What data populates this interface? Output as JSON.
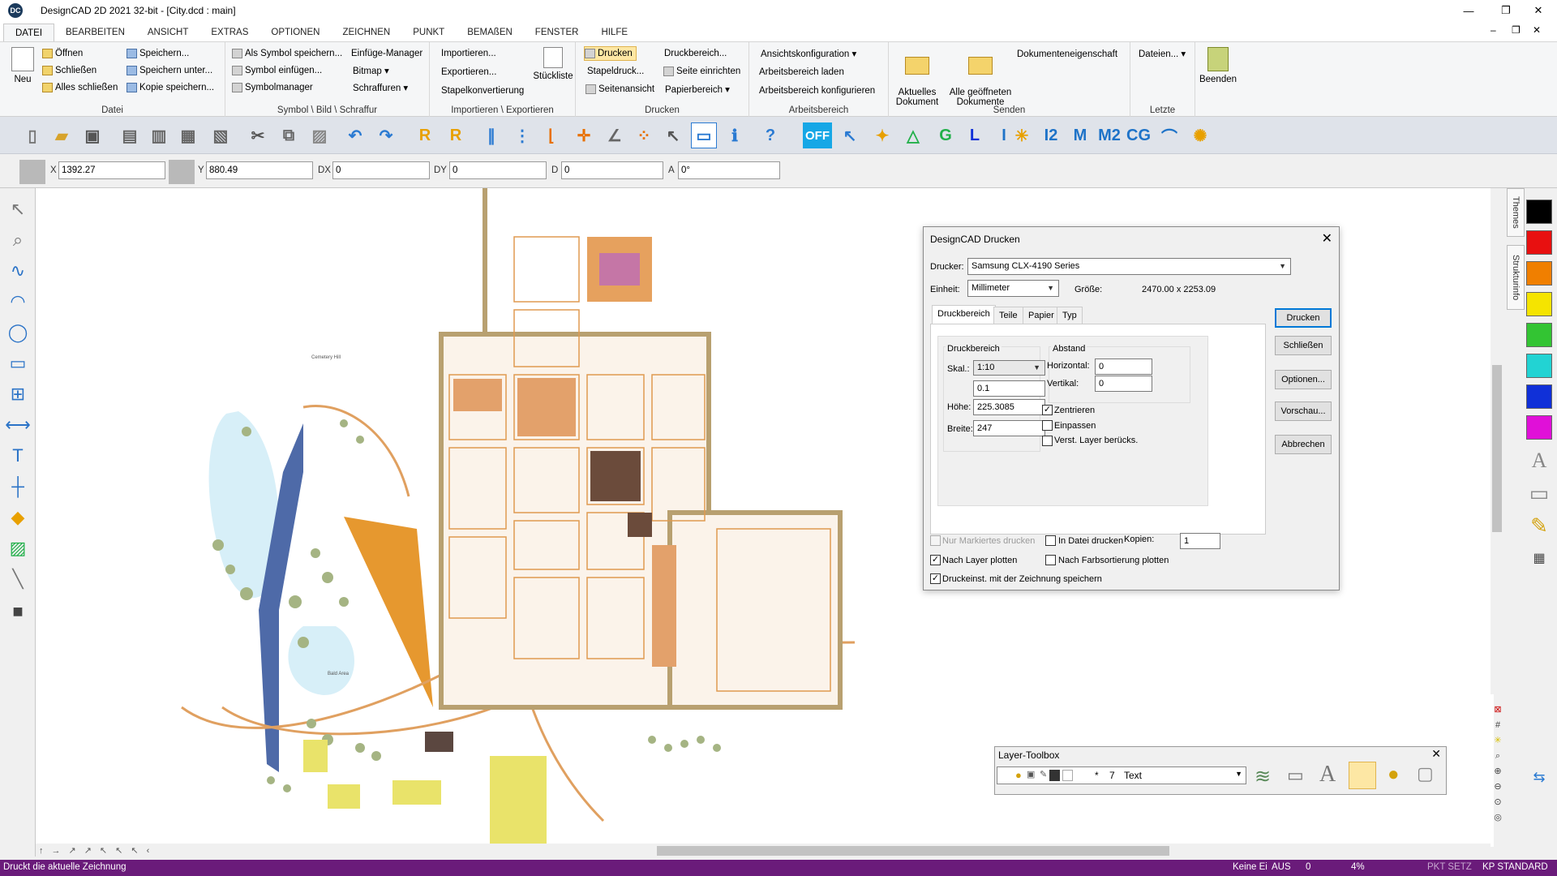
{
  "window": {
    "app_icon_text": "DC",
    "title": "DesignCAD 2D 2021 32-bit - [City.dcd : main]",
    "controls": {
      "minimize": "—",
      "restore": "❐",
      "close": "✕"
    },
    "doc_controls": {
      "minimize": "–",
      "restore": "❐",
      "close": "✕"
    }
  },
  "menu": {
    "tabs": [
      "DATEI",
      "BEARBEITEN",
      "ANSICHT",
      "EXTRAS",
      "OPTIONEN",
      "ZEICHNEN",
      "PUNKT",
      "BEMAßEN",
      "FENSTER",
      "HILFE"
    ],
    "active": "DATEI"
  },
  "ribbon": {
    "datei": {
      "label": "Datei",
      "neu": "Neu",
      "oeffnen": "Öffnen",
      "schliessen": "Schließen",
      "alles_schliessen": "Alles schließen",
      "speichern": "Speichern...",
      "speichern_unter": "Speichern unter...",
      "kopie_speichern": "Kopie speichern..."
    },
    "symbol": {
      "label": "Symbol \\ Bild \\ Schraffur",
      "als_symbol": "Als Symbol speichern...",
      "symbol_einfuegen": "Symbol einfügen...",
      "symbolmanager": "Symbolmanager",
      "einfuege_manager": "Einfüge-Manager",
      "bitmap": "Bitmap ▾",
      "schraffuren": "Schraffuren ▾"
    },
    "import": {
      "label": "Importieren \\ Exportieren",
      "importieren": "Importieren...",
      "exportieren": "Exportieren...",
      "stapelkonvertierung": "Stapelkonvertierung",
      "stueckliste": "Stückliste"
    },
    "drucken": {
      "label": "Drucken",
      "drucken": "Drucken",
      "stapeldruck": "Stapeldruck...",
      "seitenansicht": "Seitenansicht",
      "druckbereich": "Druckbereich...",
      "seite_einrichten": "Seite einrichten",
      "papierbereich": "Papierbereich ▾"
    },
    "arbeitsbereich": {
      "label": "Arbeitsbereich",
      "ansichtskonfiguration": "Ansichtskonfiguration ▾",
      "laden": "Arbeitsbereich laden",
      "konfigurieren": "Arbeitsbereich konfigurieren"
    },
    "senden": {
      "label": "Senden",
      "aktuelles": "Aktuelles\nDokument",
      "alle": "Alle geöffneten\nDokumente",
      "dokumenteigenschaft": "Dokumenteneigenschaft"
    },
    "letzte": {
      "label": "Letzte",
      "dateien": "Dateien... ▾"
    },
    "beenden": "Beenden"
  },
  "coords": {
    "x_label": "X",
    "x_value": "1392.27",
    "y_label": "Y",
    "y_value": "880.49",
    "dx_label": "DX",
    "dx_value": "0",
    "dy_label": "DY",
    "dy_value": "0",
    "d_label": "D",
    "d_value": "0",
    "a_label": "A",
    "a_value": "0°"
  },
  "toolbar": {
    "off_label": "OFF"
  },
  "right_panel": {
    "themes_tab": "Themes",
    "struktur_tab": "Strukturinfo",
    "colors": [
      "#000000",
      "#e81010",
      "#f07f00",
      "#f5e400",
      "#33c433",
      "#22d3d3",
      "#1030d8",
      "#e010d8"
    ]
  },
  "canvas": {
    "label_cemetery": "Cemetery Hill",
    "label_pond": "Bald Area"
  },
  "dialog": {
    "title": "DesignCAD Drucken",
    "drucker_label": "Drucker:",
    "drucker_value": "Samsung CLX-4190 Series",
    "einheit_label": "Einheit:",
    "einheit_value": "Millimeter",
    "groesse_label": "Größe:",
    "groesse_value": "2470.00 x 2253.09",
    "tabs": [
      "Druckbereich",
      "Teile",
      "Papier",
      "Typ"
    ],
    "druckbereich_group": "Druckbereich",
    "skal_label": "Skal.:",
    "skal_value": "1:10",
    "skal_factor": "0.1",
    "hoehe_label": "Höhe:",
    "hoehe_value": "225.3085",
    "breite_label": "Breite:",
    "breite_value": "247",
    "abstand_group": "Abstand",
    "horizontal_label": "Horizontal:",
    "horizontal_value": "0",
    "vertikal_label": "Vertikal:",
    "vertikal_value": "0",
    "zentrieren": "Zentrieren",
    "einpassen": "Einpassen",
    "verst_layer": "Verst. Layer berücks.",
    "nur_markiertes": "Nur Markiertes drucken",
    "in_datei": "In Datei drucken",
    "kopien_label": "Kopien:",
    "kopien_value": "1",
    "nach_layer": "Nach Layer plotten",
    "nach_farb": "Nach Farbsortierung plotten",
    "druckeinst": "Druckeinst. mit der Zeichnung speichern",
    "btn_drucken": "Drucken",
    "btn_schliessen": "Schließen",
    "btn_optionen": "Optionen...",
    "btn_vorschau": "Vorschau...",
    "btn_abbrechen": "Abbrechen",
    "close": "✕"
  },
  "layer_toolbox": {
    "title": "Layer-Toolbox",
    "layer_star": "*",
    "layer_number": "7",
    "layer_name": "Text",
    "close": "✕"
  },
  "status": {
    "message": "Druckt die aktuelle Zeichnung",
    "keine": "Keine Ei",
    "aus": "AUS",
    "zero": "0",
    "zoom": "4%",
    "pkt": "PKT SETZ",
    "kp": "KP STANDARD"
  }
}
